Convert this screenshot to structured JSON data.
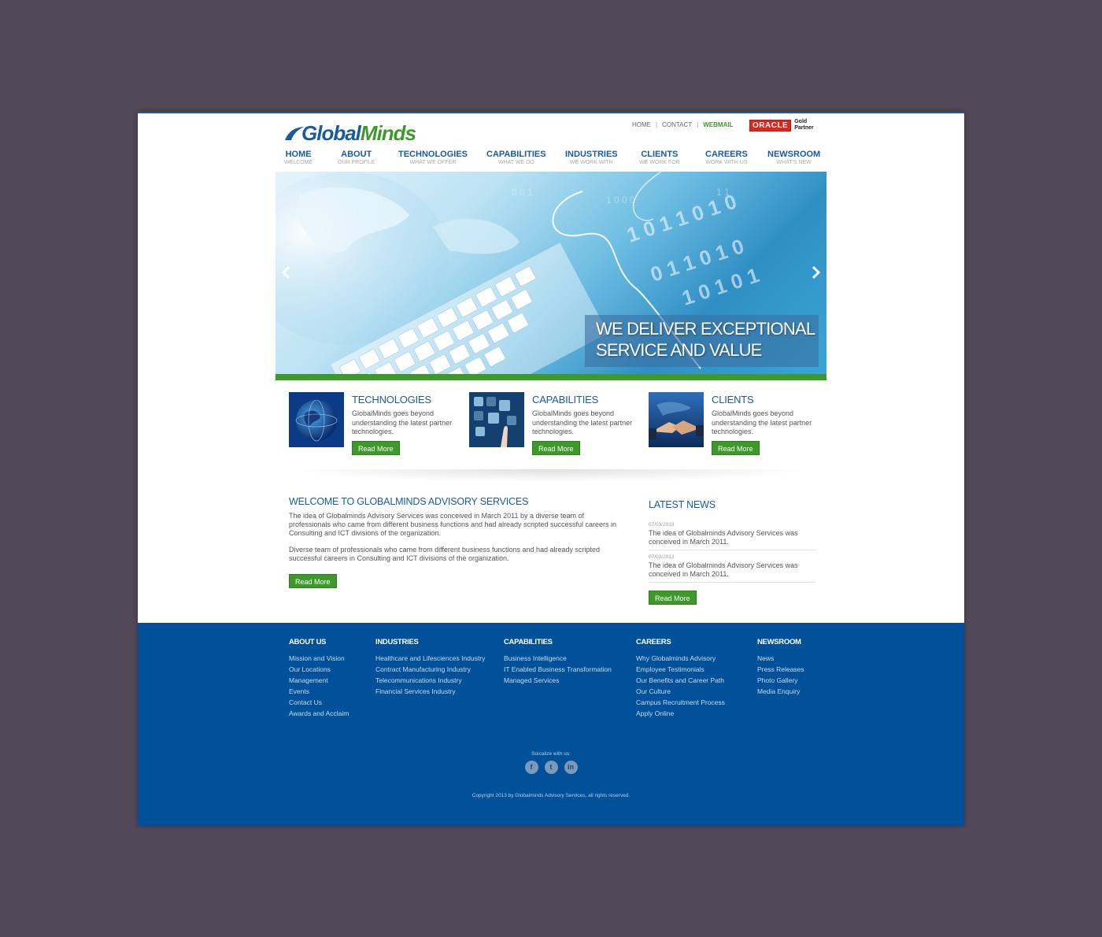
{
  "brand": {
    "name_part1": "Global",
    "name_part2": "Minds",
    "oracle_badge": "ORACLE",
    "oracle_gold": "Gold",
    "oracle_partner": "Partner"
  },
  "toplinks": {
    "home": "HOME",
    "contact": "CONTACT",
    "webmail": "WEBMAIL",
    "separator": "|"
  },
  "nav": [
    {
      "label": "HOME",
      "sub": "WELCOME"
    },
    {
      "label": "ABOUT",
      "sub": "OUR PROFILE"
    },
    {
      "label": "TECHNOLOGIES",
      "sub": "WHAT WE OFFER"
    },
    {
      "label": "CAPABILITIES",
      "sub": "WHAT WE DO"
    },
    {
      "label": "INDUSTRIES",
      "sub": "WE WORK WITH"
    },
    {
      "label": "CLIENTS",
      "sub": "WE WORK FOR"
    },
    {
      "label": "CAREERS",
      "sub": "WORK WITH US"
    },
    {
      "label": "NEWSROOM",
      "sub": "WHAT'S NEW"
    }
  ],
  "hero": {
    "line1": "WE DELIVER EXCEPTIONAL",
    "line2": "SERVICE AND VALUE"
  },
  "features": [
    {
      "title": "TECHNOLOGIES",
      "desc": "GlobalMinds goes beyond understanding the latest partner technologies.",
      "button": "Read More"
    },
    {
      "title": "CAPABILITIES",
      "desc": "GlobalMinds goes beyond understanding the latest partner technologies.",
      "button": "Read More"
    },
    {
      "title": "CLIENTS",
      "desc": "GlobalMinds goes beyond understanding the latest partner technologies.",
      "button": "Read More"
    }
  ],
  "welcome": {
    "title": "WELCOME TO GLOBALMINDS ADVISORY SERVICES",
    "para1": "The idea of Globalminds Advisory Services was conceived in March 2011 by a diverse team of professionals who came from different business functions and had already scripted successful careers in Consulting and ICT divisions of the organization.",
    "para2": "Diverse team of professionals who came from different business functions and had already scripted successful careers in Consulting and ICT divisions of the organization.",
    "button": "Read More"
  },
  "news": {
    "title": "LATEST NEWS",
    "items": [
      {
        "date": "07/03/2013",
        "text": "The idea of Globalminds Advisory Services was conceived in March 2011."
      },
      {
        "date": "07/03/2013",
        "text": "The idea of Globalminds Advisory Services was conceived in March 2011."
      }
    ],
    "button": "Read More"
  },
  "footer": {
    "columns": [
      {
        "title": "ABOUT US",
        "links": [
          "Mission and Vision",
          "Our Locations",
          "Management",
          "Events",
          "Contact Us",
          "Awards and Acclaim"
        ]
      },
      {
        "title": "INDUSTRIES",
        "links": [
          "Healthcare and Lifesciences Industry",
          "Contract Manufacturing Industry",
          "Telecommunications Industry",
          "Financial Services Industry"
        ]
      },
      {
        "title": "CAPABILITIES",
        "links": [
          "Business Intelligence",
          "IT Enabled Business Transformation",
          "Managed Services"
        ]
      },
      {
        "title": "CAREERS",
        "links": [
          "Why Globalminds Advisory",
          "Employee Testimonials",
          "Our Benefits and Career Path",
          "Our Culture",
          "Campus Recruitment Process",
          "Apply Online"
        ]
      },
      {
        "title": "NEWSROOM",
        "links": [
          "News",
          "Press Releases",
          "Photo Gallery",
          "Media Enquiry"
        ]
      }
    ],
    "social_label": "Soicalize with us:",
    "social_icons": [
      "f",
      "t",
      "in"
    ],
    "copyright": "Copyright 2013 by Globalminds Advisory Services, all rights reserved."
  },
  "colors": {
    "brand_blue": "#1a5aa0",
    "brand_green": "#3d9a2a",
    "footer_blue": "#005199",
    "background": "#524858"
  }
}
